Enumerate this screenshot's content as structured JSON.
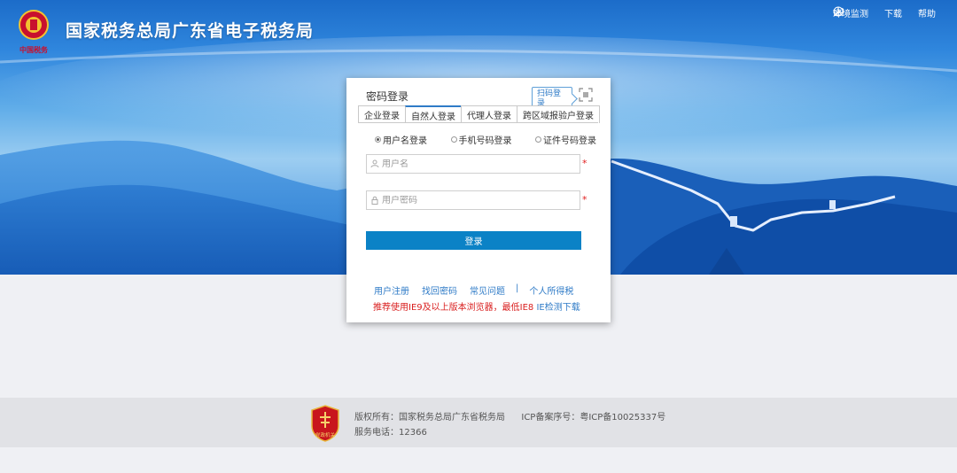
{
  "header": {
    "logo_text": "中国税务",
    "site_title": "国家税务总局广东省电子税务局",
    "links": [
      {
        "icon": "wrench-icon",
        "label": "环境监测"
      },
      {
        "icon": "download-icon",
        "label": "下载"
      },
      {
        "icon": "help-icon",
        "label": "帮助"
      }
    ]
  },
  "login": {
    "title": "密码登录",
    "qr_tip": "扫码登录",
    "tabs": [
      "企业登录",
      "自然人登录",
      "代理人登录",
      "跨区域报验户登录"
    ],
    "active_tab": "自然人登录",
    "radios": [
      "用户名登录",
      "手机号码登录",
      "证件号码登录"
    ],
    "selected_radio": "用户名登录",
    "username_placeholder": "用户名",
    "password_placeholder": "用户密码",
    "required_mark": "*",
    "login_button": "登录",
    "links": [
      "用户注册",
      "找回密码",
      "常见问题",
      "|",
      "个人所得税"
    ],
    "notice_red": "推荐使用IE9及以上版本浏览器，最低IE8",
    "notice_link": "IE检测下载"
  },
  "footer": {
    "badge_text": "党政机关",
    "copyright": "版权所有：国家税务总局广东省税务局",
    "icp": "ICP备案序号：粤ICP备10025337号",
    "phone": "服务电话：12366"
  },
  "colors": {
    "primary": "#0b82c6",
    "link": "#2f7bc7",
    "required": "#e02020",
    "notice": "#d91e1e"
  }
}
